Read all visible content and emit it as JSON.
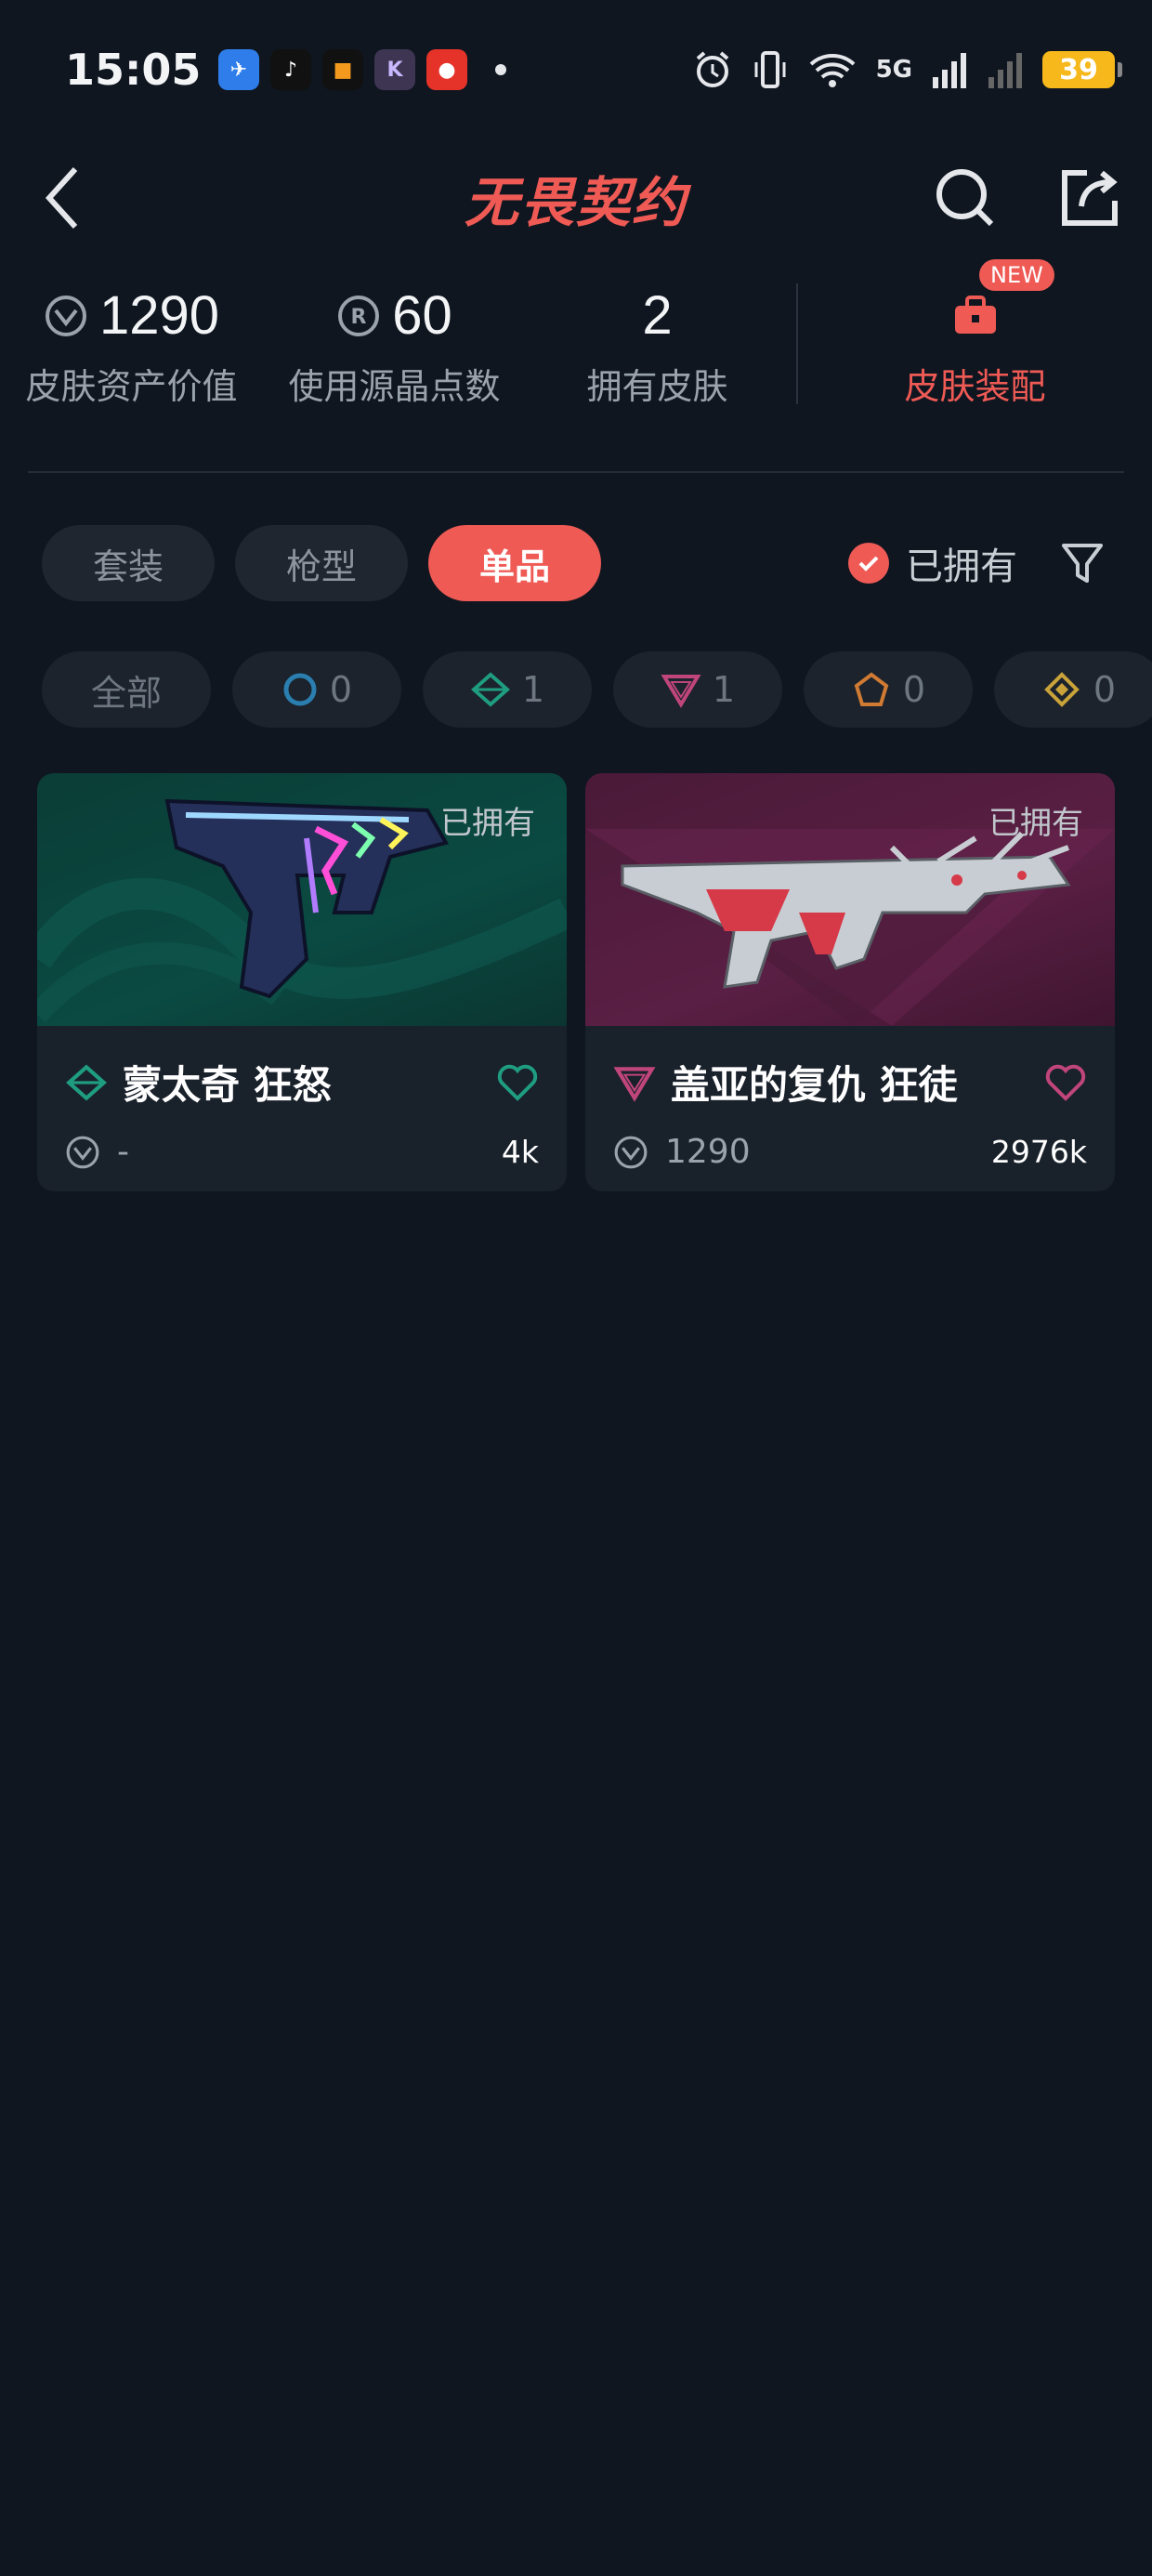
{
  "status_bar": {
    "time": "15:05",
    "battery": "39",
    "network": "5G",
    "notification_apps": [
      "feishu-icon",
      "tiktok-icon",
      "orange-app-icon",
      "k-app-icon",
      "red-app-icon"
    ]
  },
  "nav": {
    "title": "无畏契约"
  },
  "stats": {
    "asset_value": "1290",
    "asset_label": "皮肤资产价值",
    "radianite": "60",
    "radianite_label": "使用源晶点数",
    "skin_count": "2",
    "skin_count_label": "拥有皮肤",
    "equip_label": "皮肤装配",
    "new_badge": "NEW"
  },
  "tabs": [
    "套装",
    "枪型",
    "单品"
  ],
  "active_tab": "单品",
  "owned_filter_label": "已拥有",
  "rarity_chips": [
    {
      "label": "全部"
    },
    {
      "icon": "select-tier-icon",
      "count": "0",
      "color": "#2a7fb0"
    },
    {
      "icon": "deluxe-tier-icon",
      "count": "1",
      "color": "#1f9d80"
    },
    {
      "icon": "premium-tier-icon",
      "count": "1",
      "color": "#c0457a"
    },
    {
      "icon": "ultra-tier-icon",
      "count": "0",
      "color": "#d07a33"
    },
    {
      "icon": "exclusive-tier-icon",
      "count": "0",
      "color": "#c9a23a"
    }
  ],
  "skins": [
    {
      "name": "蒙太奇 狂怒",
      "owned_tag": "已拥有",
      "price": "-",
      "likes": "4k",
      "tier_color": "#1f9d80",
      "tier_icon": "deluxe-tier-icon"
    },
    {
      "name": "盖亚的复仇 狂徒",
      "owned_tag": "已拥有",
      "price": "1290",
      "likes": "2976k",
      "tier_color": "#c0457a",
      "tier_icon": "premium-tier-icon"
    }
  ],
  "colors": {
    "accent": "#ef5a55",
    "background": "#0f1620"
  }
}
